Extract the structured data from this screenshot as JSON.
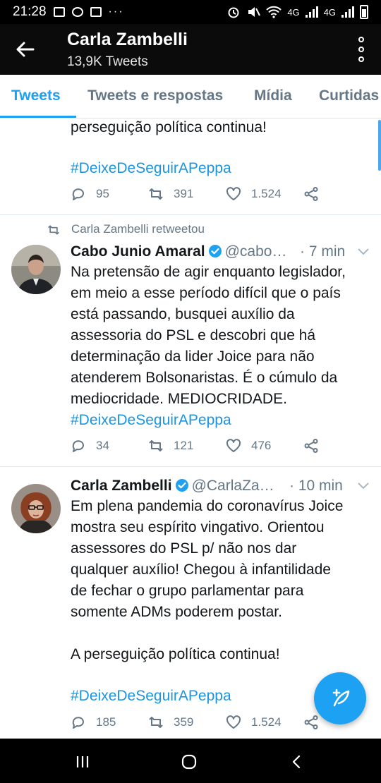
{
  "status_bar": {
    "time": "21:28",
    "network_label_1": "4G",
    "network_label_2": "4G"
  },
  "header": {
    "title": "Carla Zambelli",
    "subtitle": "13,9K Tweets"
  },
  "tabs": [
    {
      "label": "Tweets",
      "active": true
    },
    {
      "label": "Tweets e respostas",
      "active": false
    },
    {
      "label": "Mídia",
      "active": false
    },
    {
      "label": "Curtidas",
      "active": false
    }
  ],
  "tweets": [
    {
      "text": "perseguição política continua!",
      "hashtag": "#DeixeDeSeguirAPeppa",
      "replies": "95",
      "retweets": "391",
      "likes": "1.524"
    },
    {
      "retweet_label": "Carla Zambelli retweetou",
      "name": "Cabo Junio Amaral",
      "handle": "@cabo…",
      "time": "· 7 min",
      "text": "Na pretensão de agir enquanto legislador,\nem meio a esse período difícil que o país\nestá passando, busquei auxílio da\nassessoria do PSL e descobri que há\ndeterminação da lider Joice para não\natenderem Bolsonaristas. É o cúmulo da\nmediocridade. MEDIOCRIDADE.",
      "hashtag": "#DeixeDeSeguirAPeppa",
      "replies": "34",
      "retweets": "121",
      "likes": "476"
    },
    {
      "name": "Carla Zambelli",
      "handle": "@CarlaZa…",
      "time": "· 10 min",
      "text": "Em plena pandemia do coronavírus Joice\nmostra seu espírito vingativo. Orientou\nassessores do PSL p/ não nos dar\nqualquer auxílio! Chegou à infantilidade\nde fechar o grupo parlamentar para\nsomente ADMs poderem postar.\n\nA perseguição política continua!",
      "hashtag": "#DeixeDeSeguirAPeppa",
      "replies": "185",
      "retweets": "359",
      "likes": "1.524"
    }
  ],
  "colors": {
    "accent": "#1da1f2",
    "hashtag": "#1b95e0",
    "muted": "#657786",
    "header_bg": "#0b0b0b"
  }
}
